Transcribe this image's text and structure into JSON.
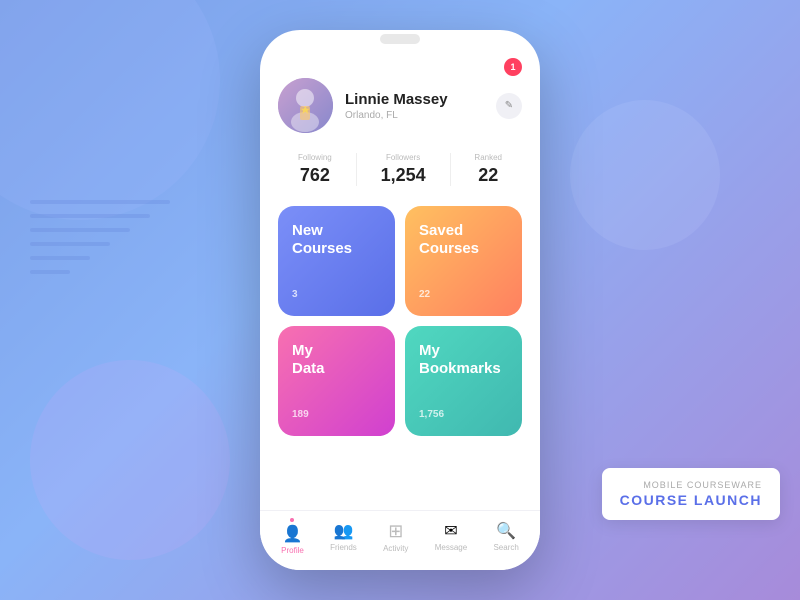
{
  "background": {
    "gradient_start": "#7b9fe8",
    "gradient_end": "#a78bda"
  },
  "label_card": {
    "subtitle": "Mobile Courseware",
    "title": "Course Launch"
  },
  "notification": {
    "badge_count": "1"
  },
  "profile": {
    "name": "Linnie Massey",
    "location": "Orlando, FL",
    "edit_label": "✏"
  },
  "stats": [
    {
      "label": "Following",
      "value": "762"
    },
    {
      "label": "Followers",
      "value": "1,254"
    },
    {
      "label": "Ranked",
      "value": "22"
    }
  ],
  "cards": [
    {
      "id": "new-courses",
      "title": "New Courses",
      "count": "3",
      "class": "card-new-courses"
    },
    {
      "id": "saved-courses",
      "title": "Saved Courses",
      "count": "22",
      "class": "card-saved-courses"
    },
    {
      "id": "my-data",
      "title": "My Data",
      "count": "189",
      "class": "card-my-data"
    },
    {
      "id": "my-bookmarks",
      "title": "My Bookmarks",
      "count": "1,756",
      "class": "card-my-bookmarks"
    }
  ],
  "nav": [
    {
      "id": "profile",
      "label": "Profile",
      "icon": "👤",
      "active": true
    },
    {
      "id": "friends",
      "label": "Friends",
      "icon": "👥",
      "active": false
    },
    {
      "id": "activity",
      "label": "Activity",
      "icon": "▦",
      "active": false
    },
    {
      "id": "message",
      "label": "Message",
      "icon": "✉",
      "active": false
    },
    {
      "id": "search",
      "label": "Search",
      "icon": "🔍",
      "active": false
    }
  ]
}
